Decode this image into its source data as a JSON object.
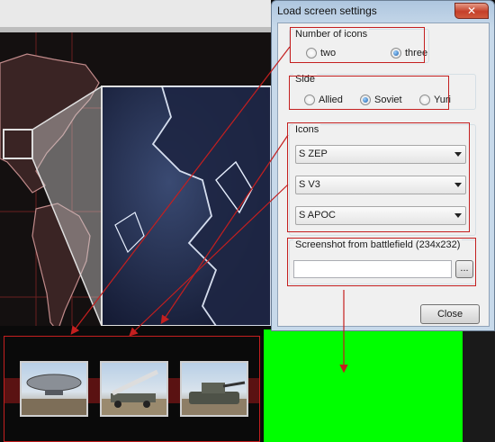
{
  "dialog": {
    "title": "Load screen settings",
    "close_glyph": "✕",
    "number_of_icons": {
      "label": "Number of icons",
      "options": [
        "two",
        "three"
      ],
      "selected": "three"
    },
    "side": {
      "label": "Side",
      "options": [
        "Allied",
        "Soviet",
        "Yuri"
      ],
      "selected": "Soviet"
    },
    "icons": {
      "label": "Icons",
      "selects": [
        "S ZEP",
        "S V3",
        "S APOC"
      ]
    },
    "screenshot": {
      "label": "Screenshot from battlefield (234x232)",
      "value": "",
      "browse_label": "..."
    },
    "close_button": "Close"
  },
  "colors": {
    "annotation_red": "#c41f1f",
    "preview_green": "#00ff00",
    "map_line": "#b07070"
  },
  "tray": {
    "thumbnails": [
      "zeppelin-unit",
      "v3-launcher-unit",
      "apocalypse-tank-unit"
    ]
  }
}
